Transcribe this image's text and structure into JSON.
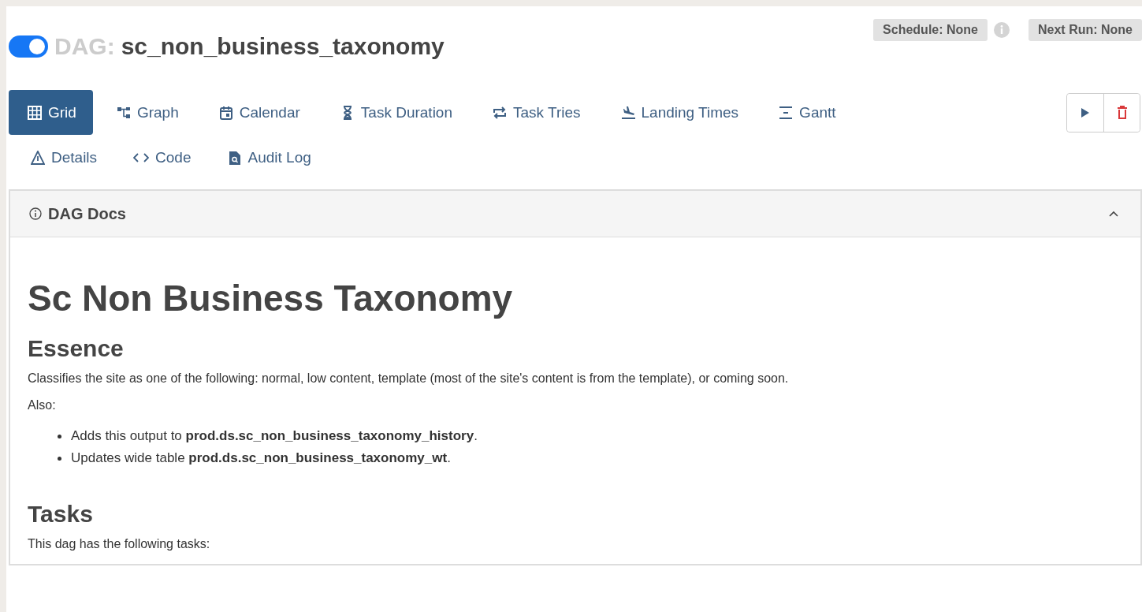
{
  "dag": {
    "paused_toggle": {
      "on": true
    },
    "prefix": "DAG:",
    "name": "sc_non_business_taxonomy"
  },
  "badges": [
    {
      "label": "Schedule: None",
      "info": true
    },
    {
      "label": "Next Run: None",
      "info": false
    }
  ],
  "tabs": [
    {
      "label": "Grid",
      "selected": true
    },
    {
      "label": "Graph",
      "selected": false
    },
    {
      "label": "Calendar",
      "selected": false
    },
    {
      "label": "Task Duration",
      "selected": false
    },
    {
      "label": "Task Tries",
      "selected": false
    },
    {
      "label": "Landing Times",
      "selected": false
    },
    {
      "label": "Gantt",
      "selected": false
    }
  ],
  "links": [
    {
      "label": "Details"
    },
    {
      "label": "Code"
    },
    {
      "label": "Audit Log"
    }
  ],
  "docs": {
    "title": "DAG Docs",
    "expanded": true,
    "heading": "Sc Non Business Taxonomy",
    "sections": [
      {
        "heading": "Essence",
        "paragraphs": [
          "Classifies the site as one of the following: normal, low content, template (most of the site's content is from the template), or coming soon.",
          "Also:"
        ],
        "bullets": [
          "Adds this output to **prod.ds.sc_non_business_taxonomy_history**.",
          "Updates wide table **prod.ds.sc_non_business_taxonomy_wt**."
        ]
      },
      {
        "heading": "Tasks",
        "paragraphs": [
          "This dag has the following tasks:"
        ]
      }
    ]
  }
}
